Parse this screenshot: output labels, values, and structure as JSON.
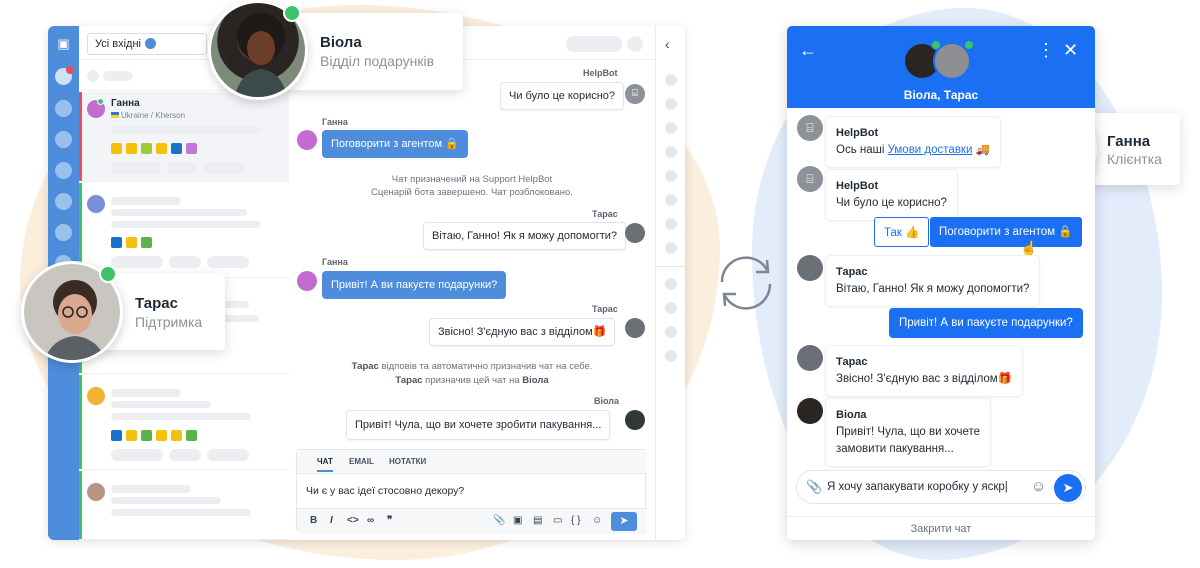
{
  "colors": {
    "accent": "#4e8ddb",
    "widget_blue": "#1a6ff2",
    "online": "#3dc46a",
    "alert": "#e84d5e"
  },
  "agent_app": {
    "inbox_selector": "Усі вхідні",
    "conversation": {
      "name": "Ганна",
      "location": "Ukraine / Kherson"
    },
    "messages": {
      "bot_label": "HelpBot",
      "bot_question": "Чи було це корисно?",
      "visitor_label_1": "Ганна",
      "visitor_reply_1": "Поговорити з агентом 🔒",
      "system_1a": "Чат призначений на Support HelpBot",
      "system_1b": "Сценарій бота завершено. Чат розблоковано.",
      "agent_label_1": "Тарас",
      "agent_greeting": "Вітаю, Ганно! Як я можу допомогти?",
      "visitor_label_2": "Ганна",
      "visitor_question": "Привіт! А ви пакуєте подарунки?",
      "agent_label_2": "Тарас",
      "agent_transfer": "Звісно! З'єдную вас з відділом🎁",
      "system_2a_name": "Тарас",
      "system_2a_text": " відповів та автоматично призначив чат на себе.",
      "system_2b_name": "Тарас",
      "system_2b_text": " призначив цей чат на ",
      "system_2b_target": "Віола",
      "agent_label_3": "Віола",
      "agent_viola_msg": "Привіт! Чула, що ви хочете зробити пакування..."
    },
    "composer": {
      "tabs": [
        "ЧАТ",
        "EMAIL",
        "НОТАТКИ"
      ],
      "text": "Чи є у вас ідеї стосовно декору?",
      "tools": [
        "B",
        "I",
        "<>",
        "∞",
        "❞"
      ],
      "right_tools": [
        "📎",
        "▣",
        "▤",
        "▭",
        "{ }",
        "☺"
      ]
    }
  },
  "profiles": {
    "viola": {
      "name": "Віола",
      "role": "Відділ подарунків"
    },
    "taras": {
      "name": "Тарас",
      "role": "Підтримка"
    },
    "hanna": {
      "name": "Ганна",
      "role": "Клієнтка"
    }
  },
  "widget": {
    "title": "Віола, Тарас",
    "messages": {
      "bot_name_1": "HelpBot",
      "bot_text_1": "Ось наші ",
      "bot_link": "Умови доставки",
      "bot_emoji": " 🚚",
      "bot_name_2": "HelpBot",
      "bot_text_2": "Чи було це корисно?",
      "btn_yes": "Так 👍",
      "btn_agent": "Поговорити з агентом 🔒",
      "agent_name_1": "Тарас",
      "agent_text_1": "Вітаю, Ганно! Як я можу допомогти?",
      "visitor_msg": "Привіт! А ви пакуєте подарунки?",
      "agent_name_2": "Тарас",
      "agent_text_2": "Звісно! З'єдную вас з відділом🎁",
      "agent_name_3": "Віола",
      "agent_text_3a": "Привіт! Чула, що ви хочете",
      "agent_text_3b": "замовити пакування..."
    },
    "input_text": "Я хочу запакувати коробку у яскр|",
    "close_label": "Закрити чат"
  }
}
